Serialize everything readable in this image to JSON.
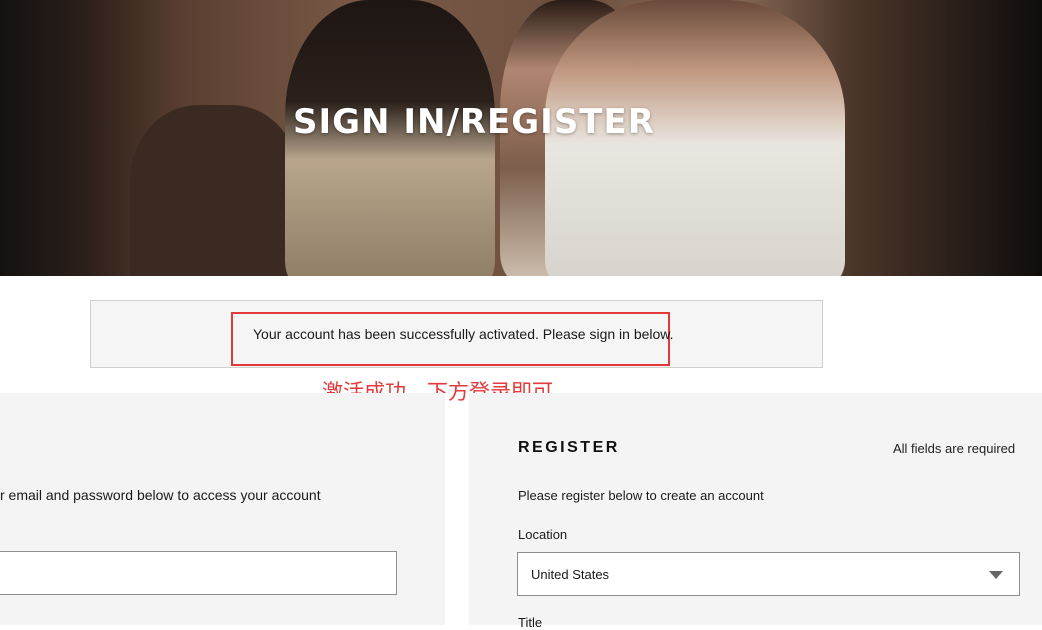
{
  "hero": {
    "title": "SIGN IN/REGISTER"
  },
  "notice": {
    "message": "Your account has been successfully activated. Please sign in below.",
    "annotation": "激活成功，下方登录即可",
    "highlight_color": "#e23a3a"
  },
  "signin": {
    "description": "r email and password below to access your account",
    "email_value": ""
  },
  "register": {
    "heading": "REGISTER",
    "required_note": "All fields are required",
    "description": "Please register below to create an account",
    "location_label": "Location",
    "location_value": "United States",
    "title_label": "Title"
  },
  "colors": {
    "panel_bg": "#f4f4f4",
    "notice_bg": "#f5f5f5",
    "annotation_red": "#e23a3a"
  }
}
